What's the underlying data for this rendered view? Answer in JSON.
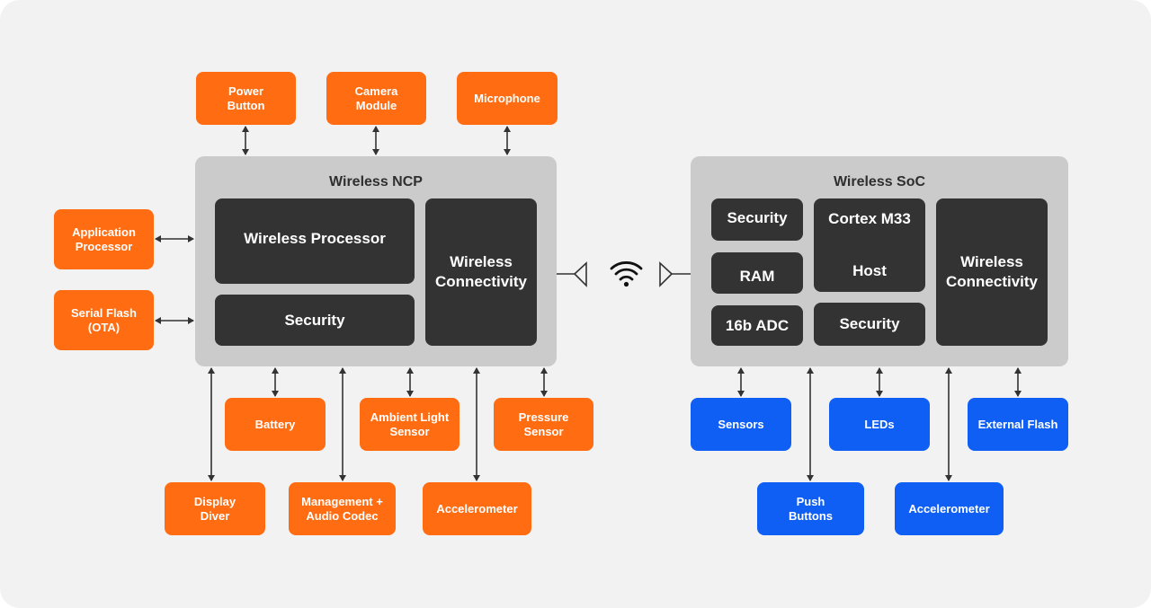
{
  "colors": {
    "peripheral_ncp": "#ff6c11",
    "peripheral_soc": "#0f5ff5",
    "chip_background": "#cbcbcb",
    "block": "#333333",
    "connector": "#333333",
    "canvas": "#f2f2f2"
  },
  "ncp": {
    "title": "Wireless NCP",
    "blocks": {
      "wireless_processor": "Wireless Processor",
      "security": "Security",
      "wireless_connectivity_1": "Wireless",
      "wireless_connectivity_2": "Connectivity"
    },
    "peripherals": {
      "power_button_1": "Power",
      "power_button_2": "Button",
      "camera_module_1": "Camera",
      "camera_module_2": "Module",
      "microphone": "Microphone",
      "application_processor_1": "Application",
      "application_processor_2": "Processor",
      "serial_flash_1": "Serial Flash",
      "serial_flash_2": "(OTA)",
      "battery": "Battery",
      "ambient_light_1": "Ambient Light",
      "ambient_light_2": "Sensor",
      "pressure_1": "Pressure",
      "pressure_2": "Sensor",
      "display_1": "Display",
      "display_2": "Diver",
      "management_1": "Management +",
      "management_2": "Audio Codec",
      "accelerometer": "Accelerometer"
    }
  },
  "link": {
    "icon": "wifi-icon"
  },
  "soc": {
    "title": "Wireless SoC",
    "blocks": {
      "security_top": "Security",
      "ram": "RAM",
      "adc": "16b ADC",
      "cortex": "Cortex M33",
      "host": "Host",
      "security_bottom": "Security",
      "wireless_connectivity_1": "Wireless",
      "wireless_connectivity_2": "Connectivity"
    },
    "peripherals": {
      "sensors": "Sensors",
      "leds": "LEDs",
      "external_flash": "External Flash",
      "push_buttons_1": "Push",
      "push_buttons_2": "Buttons",
      "accelerometer": "Accelerometer"
    }
  }
}
